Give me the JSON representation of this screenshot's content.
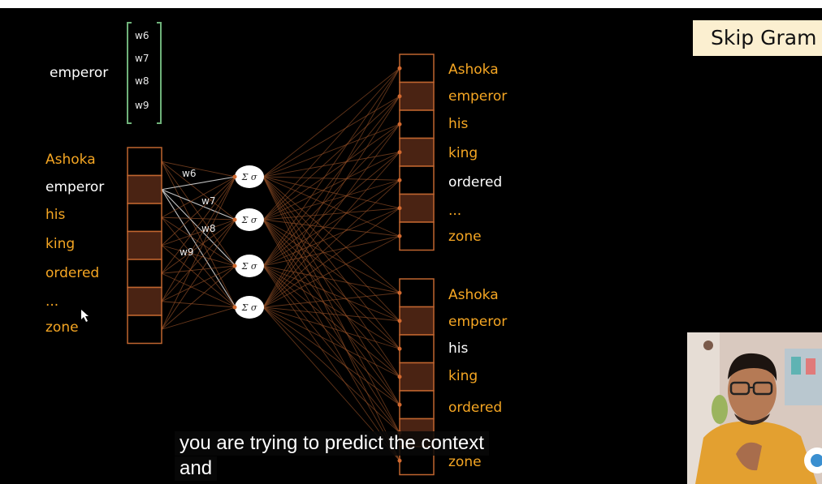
{
  "slide_title": "Skip Gram",
  "top_word": "emperor",
  "weight_vector": [
    "w6",
    "w7",
    "w8",
    "w9"
  ],
  "input_words": [
    "Ashoka",
    "emperor",
    "his",
    "king",
    "ordered",
    "...",
    "zone"
  ],
  "input_word_highlight": [
    true,
    false,
    true,
    true,
    true,
    true,
    true
  ],
  "edge_weight_labels": [
    "w6",
    "w7",
    "w8",
    "w9"
  ],
  "neuron_label": "Σ σ",
  "output_words_top": [
    "Ashoka",
    "emperor",
    "his",
    "king",
    "ordered",
    "...",
    "zone"
  ],
  "output_words_top_highlight": [
    true,
    true,
    true,
    true,
    false,
    true,
    true
  ],
  "output_words_bottom": [
    "Ashoka",
    "emperor",
    "his",
    "king",
    "ordered",
    "zone"
  ],
  "output_words_bottom_highlight": [
    true,
    true,
    false,
    true,
    true,
    true
  ],
  "caption_lines": [
    "you are trying to predict the context",
    "and"
  ],
  "colors": {
    "background": "#000000",
    "highlight_word": "#f5a623",
    "plain_word": "#ffffff",
    "box_border": "#c0652f",
    "box_fill_dark": "#4a2313",
    "connection": "#8a4a24",
    "bracket": "#6fb27a",
    "title_bg": "#fbefd0"
  }
}
